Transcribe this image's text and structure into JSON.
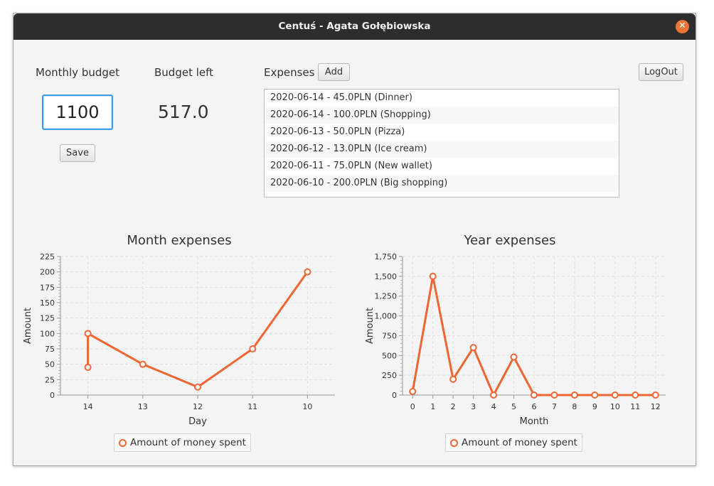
{
  "window": {
    "title": "Centuś - Agata Gołębiowska"
  },
  "budget": {
    "monthly_label": "Monthly budget",
    "monthly_value": "1100",
    "save_label": "Save",
    "left_label": "Budget left",
    "left_value": "517.0"
  },
  "expenses": {
    "label": "Expenses",
    "add_label": "Add",
    "items": [
      "2020-06-14 - 45.0PLN (Dinner)",
      "2020-06-14 - 100.0PLN (Shopping)",
      "2020-06-13 - 50.0PLN (Pizza)",
      "2020-06-12 - 13.0PLN (Ice cream)",
      "2020-06-11 - 75.0PLN (New wallet)",
      "2020-06-10 - 200.0PLN (Big shopping)"
    ]
  },
  "logout_label": "LogOut",
  "colors": {
    "accent": "#ef6633",
    "close": "#ee7436",
    "focus": "#3b9ce3"
  },
  "chart_data": [
    {
      "type": "line",
      "title": "Month expenses",
      "xlabel": "Day",
      "ylabel": "Amount",
      "categories": [
        "14",
        "13",
        "12",
        "11",
        "10"
      ],
      "x": [
        "14",
        "14",
        "13",
        "12",
        "11",
        "10"
      ],
      "ylim": [
        0,
        225
      ],
      "yticks": [
        "0",
        "25",
        "50",
        "75",
        "100",
        "125",
        "150",
        "175",
        "200",
        "225"
      ],
      "grid": true,
      "legend": "bottom",
      "series": [
        {
          "name": "Amount of money spent",
          "values": [
            45,
            100,
            50,
            13,
            75,
            200
          ]
        }
      ]
    },
    {
      "type": "line",
      "title": "Year expenses",
      "xlabel": "Month",
      "ylabel": "Amount",
      "categories": [
        "0",
        "1",
        "2",
        "3",
        "4",
        "5",
        "6",
        "7",
        "8",
        "9",
        "10",
        "11",
        "12"
      ],
      "x": [
        "0",
        "1",
        "2",
        "3",
        "4",
        "5",
        "6",
        "7",
        "8",
        "9",
        "10",
        "11",
        "12"
      ],
      "ylim": [
        0,
        1750
      ],
      "yticks": [
        "0",
        "250",
        "500",
        "750",
        "1,000",
        "1,250",
        "1,500",
        "1,750"
      ],
      "grid": true,
      "legend": "bottom",
      "series": [
        {
          "name": "Amount of money spent",
          "values": [
            45,
            1500,
            200,
            600,
            0,
            480,
            0,
            0,
            0,
            0,
            0,
            0,
            0
          ]
        }
      ]
    }
  ]
}
